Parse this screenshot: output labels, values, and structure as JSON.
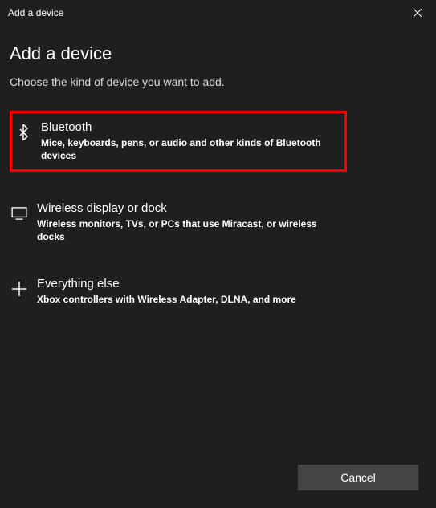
{
  "titlebar": {
    "title": "Add a device"
  },
  "heading": "Add a device",
  "subheading": "Choose the kind of device you want to add.",
  "options": [
    {
      "title": "Bluetooth",
      "desc": "Mice, keyboards, pens, or audio and other kinds of Bluetooth devices",
      "highlighted": true,
      "icon": "bluetooth"
    },
    {
      "title": "Wireless display or dock",
      "desc": "Wireless monitors, TVs, or PCs that use Miracast, or wireless docks",
      "highlighted": false,
      "icon": "display"
    },
    {
      "title": "Everything else",
      "desc": "Xbox controllers with Wireless Adapter, DLNA, and more",
      "highlighted": false,
      "icon": "plus"
    }
  ],
  "footer": {
    "cancel_label": "Cancel"
  }
}
